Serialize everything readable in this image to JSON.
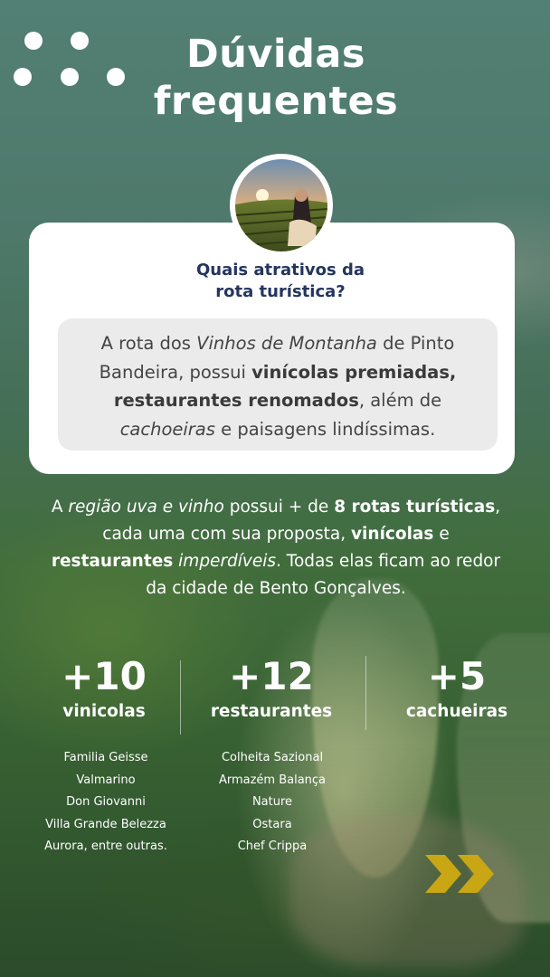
{
  "header": {
    "title_line1": "Dúvidas",
    "title_line2": "frequentes"
  },
  "card": {
    "question_line1": "Quais atrativos da",
    "question_line2": "rota turística?",
    "answer": {
      "p1": "A rota dos ",
      "p2": "Vinhos de Montanha",
      "p3": " de Pinto Bandeira, possui ",
      "p4": "vinícolas premiadas, restaurantes renomados",
      "p5": ", além de ",
      "p6": "cachoeiras",
      "p7": " e paisagens lindíssimas."
    }
  },
  "paragraph": {
    "s1": "A ",
    "s2": "região uva e vinho",
    "s3": " possui + de ",
    "s4": "8 rotas turísticas",
    "s5": ", cada uma com sua proposta, ",
    "s6": "vinícolas",
    "s7": " e ",
    "s8": "restaurantes",
    "s9": " ",
    "s10": "imperdíveis",
    "s11": ". Todas elas ficam ao redor da cidade de Bento Gonçalves."
  },
  "stats": [
    {
      "number": "+10",
      "label": "vinicolas"
    },
    {
      "number": "+12",
      "label": "restaurantes"
    },
    {
      "number": "+5",
      "label": "cachueiras"
    }
  ],
  "wineries": [
    "Familia Geisse",
    "Valmarino",
    "Don Giovanni",
    "Villa Grande Belezza",
    "Aurora, entre outras."
  ],
  "restaurants": [
    "Colheita Sazional",
    "Armazém Balança",
    "Nature",
    "Ostara",
    "Chef Crippa"
  ],
  "icons": {
    "decoration": "dots-decoration-icon",
    "next": "double-chevron-right-icon"
  },
  "colors": {
    "question": "#24355e",
    "answer_box": "#ebebeb",
    "arrow": "#c9a714"
  }
}
